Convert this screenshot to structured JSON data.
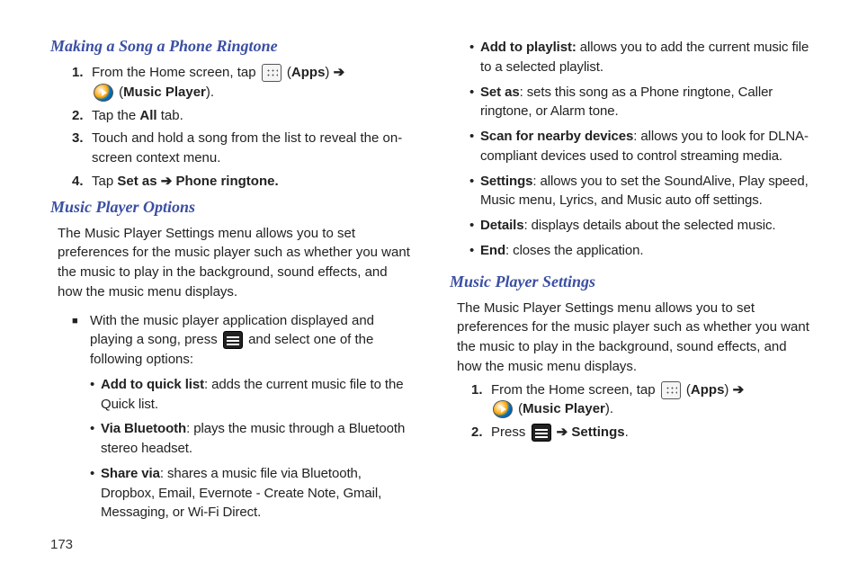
{
  "page_number": "173",
  "left": {
    "section1": {
      "title": "Making a Song a Phone Ringtone",
      "step1_num": "1.",
      "step1_a": "From the Home screen, tap ",
      "step1_b": " (",
      "step1_c": "Apps",
      "step1_d": ") ",
      "step1_arrow": "➔",
      "step1_e": " (",
      "step1_f": "Music Player",
      "step1_g": ").",
      "step2_num": "2.",
      "step2_a": "Tap the ",
      "step2_b": "All",
      "step2_c": " tab.",
      "step3_num": "3.",
      "step3": "Touch and hold a song from the list to reveal the on-screen context menu.",
      "step4_num": "4.",
      "step4_a": "Tap ",
      "step4_b": "Set as ➔ Phone ringtone."
    },
    "section2": {
      "title": "Music Player Options",
      "para": "The Music Player Settings menu allows you to set preferences for the music player such as whether you want the music to play in the background, sound effects, and how the music menu displays.",
      "sq_a": "With the music player application displayed and playing a song, press ",
      "sq_b": " and select one of the following options:",
      "b1_label": "Add to quick list",
      "b1_text": ": adds the current music file to the Quick list.",
      "b2_label": "Via Bluetooth",
      "b2_text": ": plays the music through a Bluetooth stereo headset.",
      "b3_label": "Share via",
      "b3_text": ": shares a music file via Bluetooth, Dropbox, Email, Evernote - Create Note, Gmail, Messaging, or Wi-Fi Direct."
    }
  },
  "right": {
    "b4_label": "Add to playlist:",
    "b4_text": " allows you to add the current music file to a selected playlist.",
    "b5_label": "Set as",
    "b5_text": ": sets this song as a Phone ringtone, Caller ringtone, or Alarm tone.",
    "b6_label": "Scan for nearby devices",
    "b6_text": ": allows you to look for DLNA-compliant devices used to control streaming media.",
    "b7_label": "Settings",
    "b7_text": ": allows you to set the SoundAlive, Play speed, Music menu, Lyrics, and Music auto off settings.",
    "b8_label": "Details",
    "b8_text": ": displays details about the selected music.",
    "b9_label": "End",
    "b9_text": ": closes the application.",
    "section3": {
      "title": "Music Player Settings",
      "para": "The Music Player Settings menu allows you to set preferences for the music player such as whether you want the music to play in the background, sound effects, and how the music menu displays.",
      "step1_num": "1.",
      "step1_a": "From the Home screen, tap ",
      "step1_b": " (",
      "step1_c": "Apps",
      "step1_d": ") ",
      "step1_arrow": "➔",
      "step1_e": " (",
      "step1_f": "Music Player",
      "step1_g": ").",
      "step2_num": "2.",
      "step2_a": "Press ",
      "step2_b": " ➔ ",
      "step2_c": "Settings",
      "step2_d": "."
    }
  }
}
